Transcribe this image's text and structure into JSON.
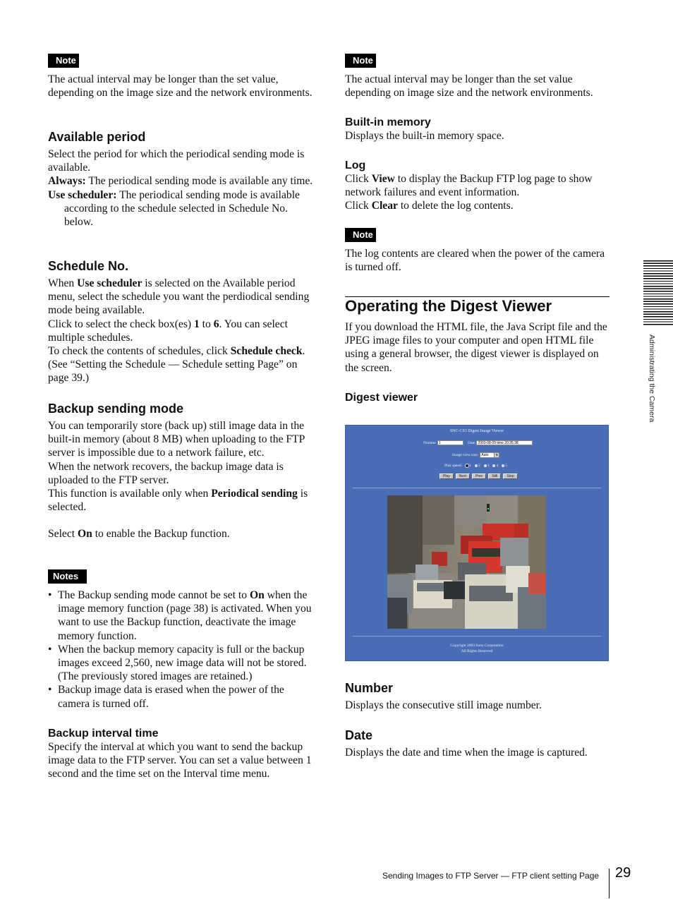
{
  "left": {
    "note1": {
      "tag": "Note",
      "text": "The actual interval may be longer than the set value, depending on the image size and the network environments."
    },
    "available_period": {
      "heading": "Available period",
      "intro": "Select the period for which the periodical sending mode is available.",
      "always_label": "Always:",
      "always_text": " The periodical sending mode is available any time.",
      "scheduler_label": "Use scheduler:",
      "scheduler_text": " The periodical sending mode is available according to the schedule selected in Schedule No. below."
    },
    "schedule_no": {
      "heading": "Schedule No.",
      "p1_a": "When ",
      "p1_b": "Use scheduler",
      "p1_c": " is selected on the Available period menu, select the schedule you want the perdiodical sending mode being available.",
      "p2_a": "Click to select the check box(es) ",
      "p2_b": "1",
      "p2_c": " to ",
      "p2_d": "6",
      "p2_e": ".  You can select multiple schedules.",
      "p3_a": "To check the contents of schedules, click ",
      "p3_b": "Schedule check",
      "p3_c": ".  (See “Setting the Schedule — Schedule setting Page” on page 39.)"
    },
    "backup_mode": {
      "heading": "Backup sending mode",
      "p1": "You can temporarily store (back up) still image data in the built-in memory (about 8 MB) when uploading to the FTP server is impossible due to a network failure, etc.",
      "p2": "When the network recovers, the backup image data is uploaded to the FTP server.",
      "p3_a": "This function is available only when ",
      "p3_b": "Periodical sending",
      "p3_c": " is selected.",
      "p4_a": "Select ",
      "p4_b": "On",
      "p4_c": " to enable the Backup function."
    },
    "notes": {
      "tag": "Notes",
      "b1_a": "The Backup sending mode cannot be set to ",
      "b1_b": "On",
      "b1_c": " when the image memory function (page 38) is activated. When you want to use the Backup function, deactivate the image memory function.",
      "b2": "When the backup memory capacity is full or the backup images exceed 2,560, new image data will not be stored. (The previously stored images are retained.)",
      "b3": "Backup image data is erased when the power of the camera is turned off."
    },
    "backup_interval": {
      "heading": "Backup interval time",
      "text": "Specify the interval at which you want to send the backup image data to the FTP server. You can set a value between 1 second and the time set on the Interval time menu."
    }
  },
  "right": {
    "note1": {
      "tag": "Note",
      "text": "The actual interval may be longer than the set value depending on image size and the network environments."
    },
    "builtin_memory": {
      "heading": "Built-in memory",
      "text": "Displays the built-in memory space."
    },
    "log": {
      "heading": "Log",
      "p1_a": "Click ",
      "p1_b": "View",
      "p1_c": " to display the Backup FTP log page to show network failures and event information.",
      "p2_a": "Click ",
      "p2_b": "Clear",
      "p2_c": " to delete the log contents."
    },
    "note2": {
      "tag": "Note",
      "text": "The log contents are cleared when the power of the camera is turned off."
    },
    "section_title": "Operating the Digest Viewer",
    "section_intro": "If you download the HTML file, the Java Script file and the JPEG image files  to your computer and open HTML file using a general browser, the digest viewer is displayed on the screen.",
    "digest_viewer_heading": "Digest viewer",
    "viewer": {
      "title": "SNC-CS3  Digest Image Viewer",
      "number_label": "Number",
      "number_value": "1",
      "date_label": "Date",
      "date_value": "2003-08-05  time  20:35:38",
      "view_size_label": "Image view size:",
      "view_size_value": "Auto",
      "play_speed_label": "Play speed:",
      "speeds": [
        "1",
        "2",
        "3",
        "4",
        "5"
      ],
      "selected_speed": "1",
      "buttons": [
        "Play",
        "Next",
        "Prev",
        "Still",
        "Stop"
      ],
      "copyright_1": "Copyright 2003 Sony Corporation",
      "copyright_2": "All Rights Reserved"
    },
    "number": {
      "heading": "Number",
      "text": "Displays the consecutive still image number."
    },
    "date": {
      "heading": "Date",
      "text": "Displays the date and time when the image is captured."
    }
  },
  "side_tab": "Administrating the Camera",
  "footer": {
    "running_title": "Sending Images to FTP Server — FTP client setting Page",
    "page_number": "29"
  }
}
